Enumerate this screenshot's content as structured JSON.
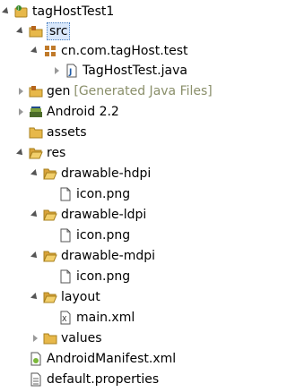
{
  "project": {
    "name": "tagHostTest1"
  },
  "src": {
    "label": "src"
  },
  "package": {
    "label": "cn.com.tagHost.test"
  },
  "java_file": {
    "label": "TagHostTest.java"
  },
  "gen": {
    "label": "gen",
    "decoration": "[Generated Java Files]"
  },
  "android_lib": {
    "label": "Android 2.2"
  },
  "assets": {
    "label": "assets"
  },
  "res": {
    "label": "res"
  },
  "drawable_hdpi": {
    "label": "drawable-hdpi",
    "file": "icon.png"
  },
  "drawable_ldpi": {
    "label": "drawable-ldpi",
    "file": "icon.png"
  },
  "drawable_mdpi": {
    "label": "drawable-mdpi",
    "file": "icon.png"
  },
  "layout": {
    "label": "layout",
    "file": "main.xml"
  },
  "values": {
    "label": "values"
  },
  "manifest": {
    "label": "AndroidManifest.xml"
  },
  "properties": {
    "label": "default.properties"
  },
  "colors": {
    "folder": "#e7b84a",
    "selection": "#3399ff",
    "decoration": "#8a8f6a"
  }
}
